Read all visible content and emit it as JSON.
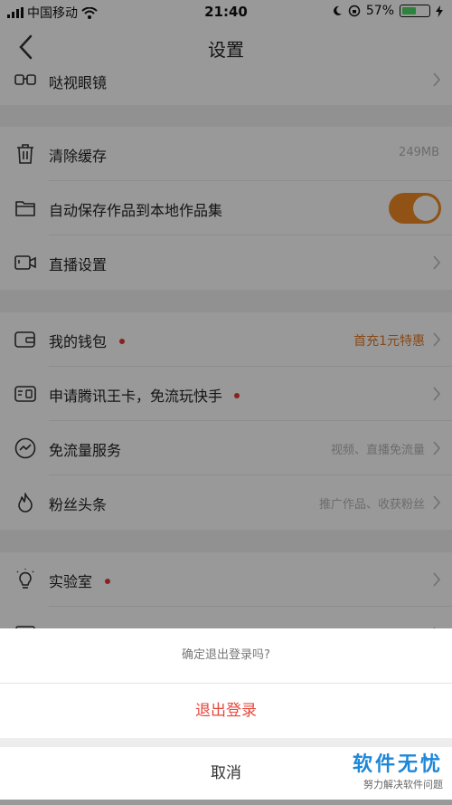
{
  "status_bar": {
    "carrier": "中国移动",
    "time": "21:40",
    "battery_percent": "57%",
    "battery_level": 0.57
  },
  "nav": {
    "title": "设置"
  },
  "settings": {
    "glasses": {
      "label": "哒视眼镜"
    },
    "clear_cache": {
      "label": "清除缓存",
      "value": "249MB"
    },
    "auto_save": {
      "label": "自动保存作品到本地作品集",
      "enabled": true
    },
    "live_settings": {
      "label": "直播设置"
    },
    "wallet": {
      "label": "我的钱包",
      "value": "首充1元特惠"
    },
    "tencent_card": {
      "label": "申请腾讯王卡，免流玩快手"
    },
    "free_data": {
      "label": "免流量服务",
      "value": "视频、直播免流量"
    },
    "fans_headline": {
      "label": "粉丝头条",
      "value": "推广作品、收获粉丝"
    },
    "lab": {
      "label": "实验室"
    }
  },
  "dialog": {
    "question": "确定退出登录吗?",
    "confirm_label": "退出登录",
    "cancel_label": "取消"
  },
  "watermark": {
    "title": "软件无忧",
    "subtitle": "努力解决软件问题"
  },
  "colors": {
    "accent_orange": "#f08a24",
    "destructive_red": "#e5483d",
    "badge_red": "#e53935",
    "watermark_blue": "#1d87d8"
  }
}
